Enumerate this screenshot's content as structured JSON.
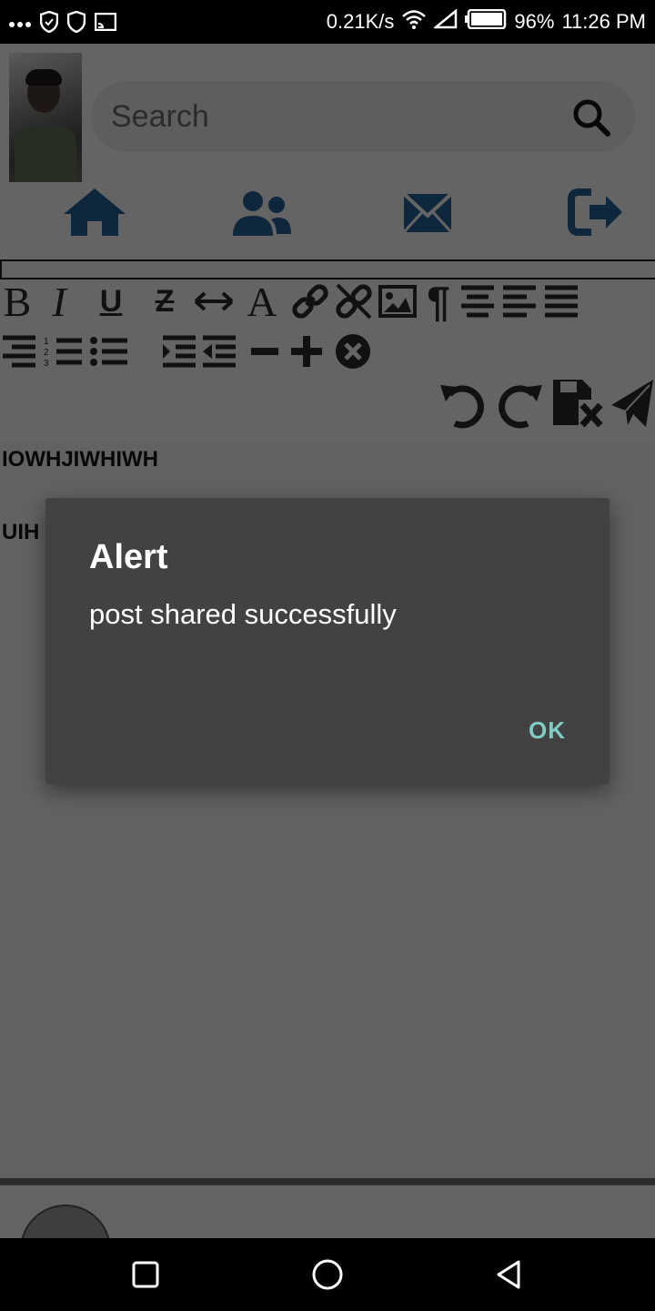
{
  "status_bar": {
    "net_speed": "0.21K/s",
    "battery": "96%",
    "time": "11:26 PM"
  },
  "search": {
    "placeholder": "Search"
  },
  "nav": {
    "icons": [
      "home-icon",
      "users-icon",
      "mail-icon",
      "logout-icon"
    ],
    "accent_color": "#1f4e7a"
  },
  "editor": {
    "lines": [
      "IOWHJIWHIWH",
      "UIH"
    ]
  },
  "dialog": {
    "title": "Alert",
    "message": "post shared successfully",
    "ok_label": "OK"
  }
}
